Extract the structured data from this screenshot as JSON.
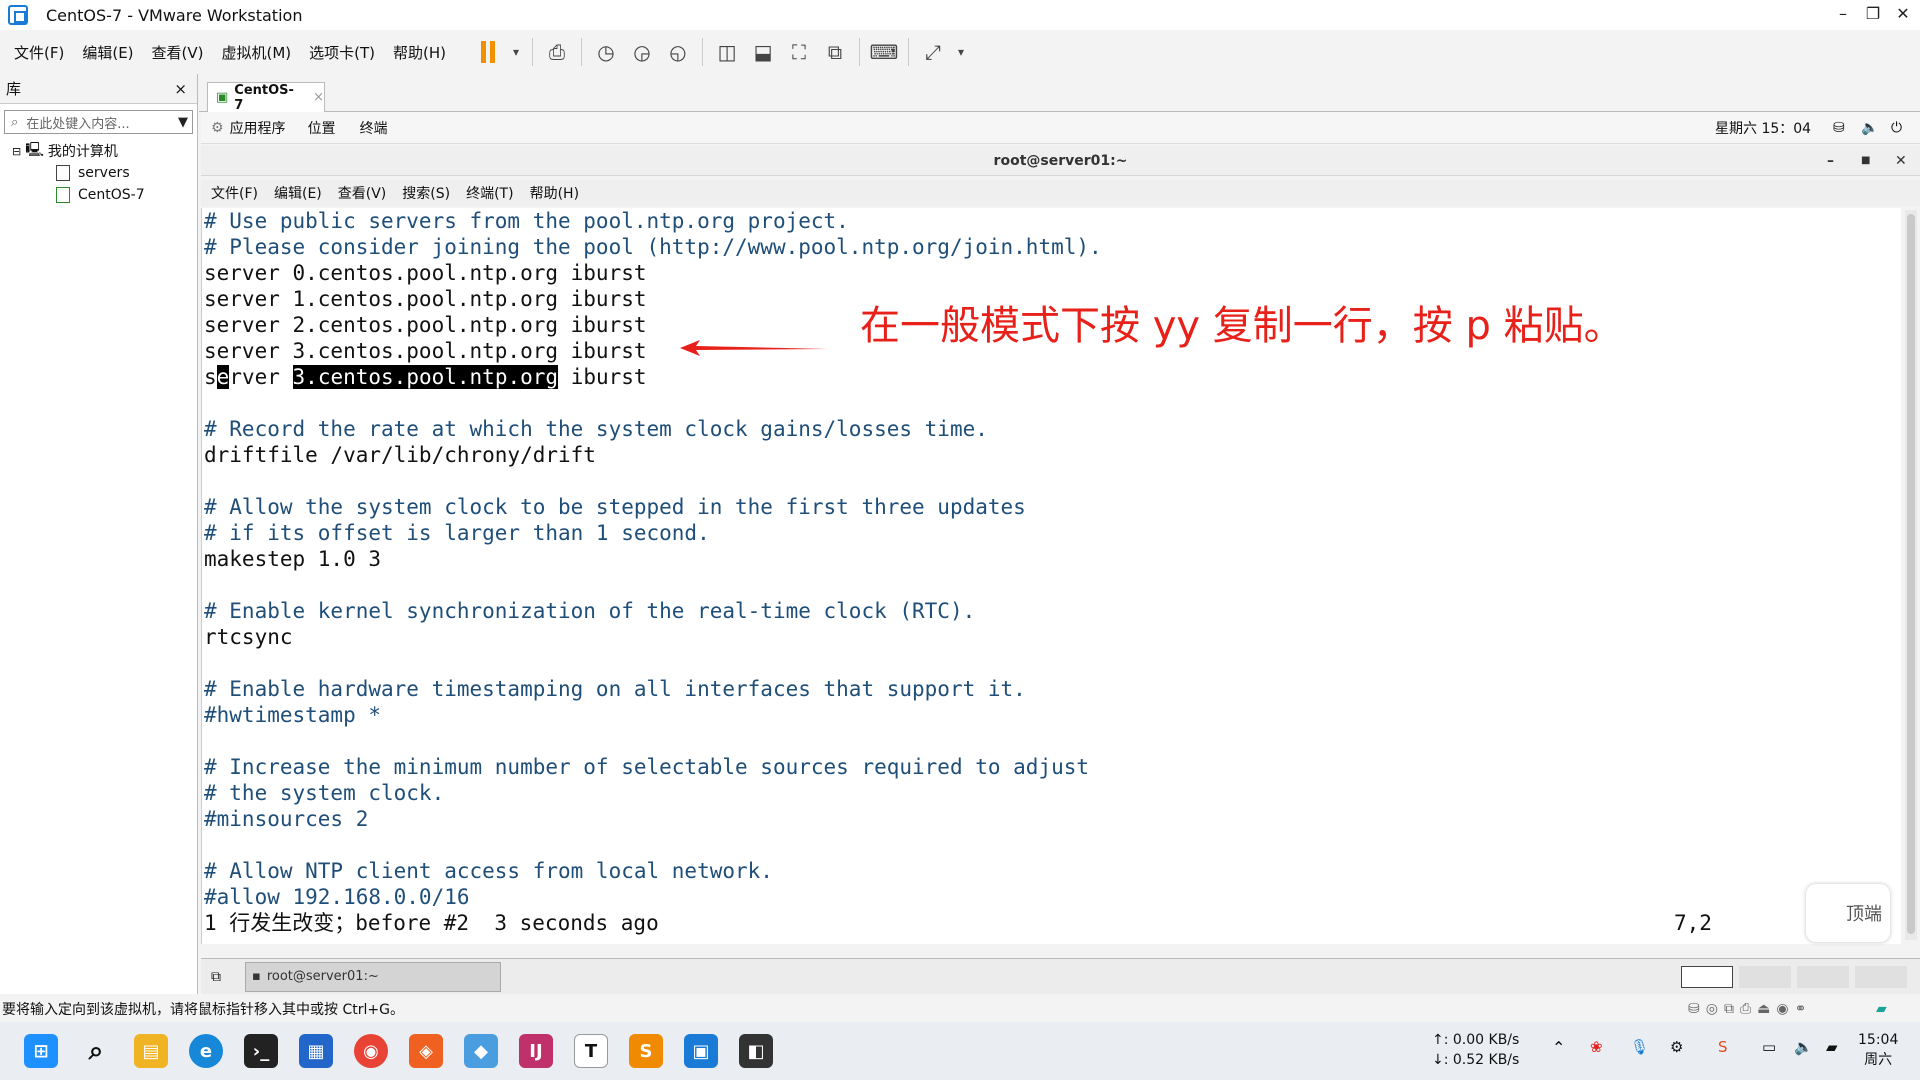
{
  "window": {
    "title": "CentOS-7 - VMware Workstation",
    "minimize": "–",
    "restore": "❐",
    "close": "✕"
  },
  "menus": [
    "文件(F)",
    "编辑(E)",
    "查看(V)",
    "虚拟机(M)",
    "选项卡(T)",
    "帮助(H)"
  ],
  "library": {
    "title": "库",
    "close": "×",
    "search_placeholder": "在此处键入内容...",
    "tree": {
      "root": "我的计算机",
      "children": [
        "servers",
        "CentOS-7"
      ]
    }
  },
  "vm_tab": {
    "label": "CentOS-7",
    "close": "×"
  },
  "gnome_panel": {
    "apps": "应用程序",
    "places": "位置",
    "terminal": "终端",
    "datetime": "星期六 15：04"
  },
  "terminal": {
    "title": "root@server01:~",
    "menus": [
      "文件(F)",
      "编辑(E)",
      "查看(V)",
      "搜索(S)",
      "终端(T)",
      "帮助(H)"
    ],
    "lines": [
      "# Use public servers from the pool.ntp.org project.",
      "# Please consider joining the pool (http://www.pool.ntp.org/join.html).",
      "server 0.centos.pool.ntp.org iburst",
      "server 1.centos.pool.ntp.org iburst",
      "server 2.centos.pool.ntp.org iburst",
      "server 3.centos.pool.ntp.org iburst",
      "",
      "",
      "# Record the rate at which the system clock gains/losses time.",
      "driftfile /var/lib/chrony/drift",
      "",
      "# Allow the system clock to be stepped in the first three updates",
      "# if its offset is larger than 1 second.",
      "makestep 1.0 3",
      "",
      "# Enable kernel synchronization of the real-time clock (RTC).",
      "rtcsync",
      "",
      "# Enable hardware timestamping on all interfaces that support it.",
      "#hwtimestamp *",
      "",
      "# Increase the minimum number of selectable sources required to adjust",
      "# the system clock.",
      "#minsources 2",
      "",
      "# Allow NTP client access from local network.",
      "#allow 192.168.0.0/16"
    ],
    "paste_line": {
      "pre": "s",
      "cursor": "e",
      "mid": "rver ",
      "highlight": "3.centos.pool.ntp.org",
      "post": " iburst"
    },
    "status_msg": "1 行发生改变；before #2  3 seconds ago",
    "cursor_pos": "7,2"
  },
  "annotation": "在一般模式下按 yy 复制一行，按 p 粘贴。",
  "goto_top": "顶端",
  "vm_taskbar_item": "root@server01:~",
  "statusbar": "要将输入定向到该虚拟机，请将鼠标指针移入其中或按 Ctrl+G。",
  "network": {
    "up": "↑: 0.00 KB/s",
    "down": "↓: 0.52 KB/s"
  },
  "clock": {
    "time": "15:04",
    "day": "周六"
  }
}
